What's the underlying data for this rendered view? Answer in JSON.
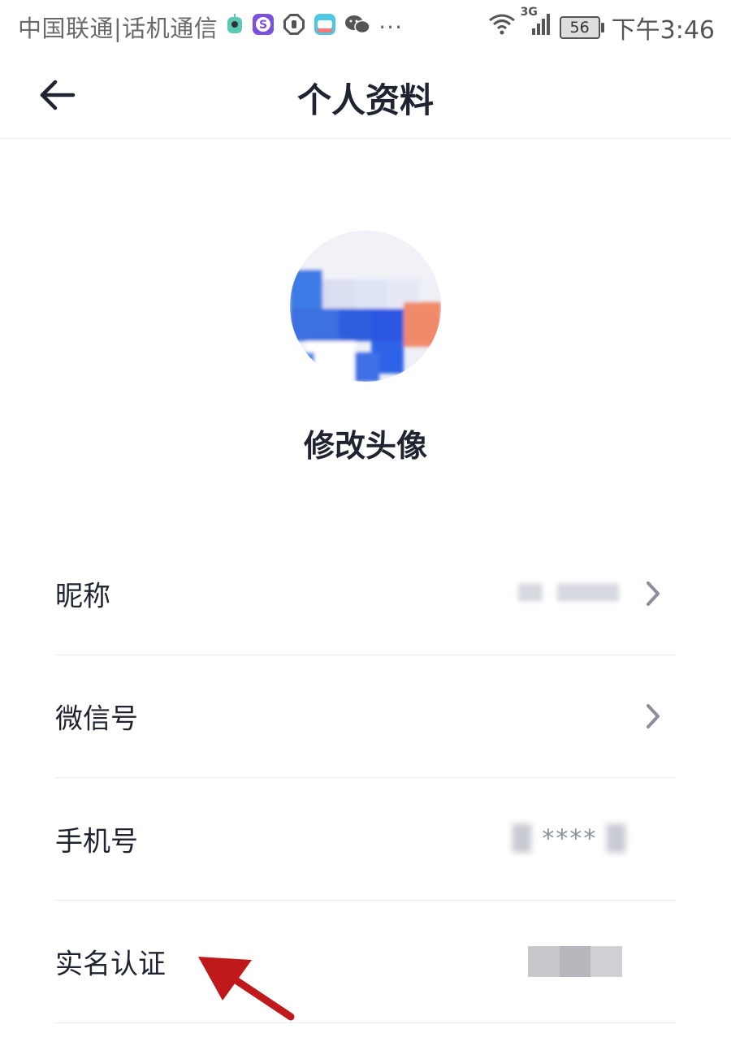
{
  "status_bar": {
    "carrier": "中国联通|话机通信",
    "app_icons": [
      "robot-app-icon",
      "soul-app-icon",
      "stop-hand-app-icon",
      "yutu-app-icon",
      "wechat-app-icon"
    ],
    "more": "···",
    "network": "3G",
    "battery": "56",
    "time": "下午3:46"
  },
  "header": {
    "back_icon": "back-arrow-icon",
    "title": "个人资料"
  },
  "profile": {
    "avatar_icon": "avatar-image",
    "change_avatar_label": "修改头像"
  },
  "rows": [
    {
      "label": "昵称",
      "value_display": "blurred",
      "has_chevron": true
    },
    {
      "label": "微信号",
      "has_chevron": true
    },
    {
      "label": "手机号",
      "value": "****",
      "has_chevron": false
    },
    {
      "label": "实名认证",
      "value_display": "pixelated",
      "has_chevron": false
    }
  ],
  "colors": {
    "text_primary": "#1f2430",
    "divider": "#ececec",
    "chevron": "#8a8f9a",
    "annotation_arrow": "#c0191c",
    "avatar_blue": "#2f63e8",
    "avatar_orange": "#f08a6a"
  }
}
